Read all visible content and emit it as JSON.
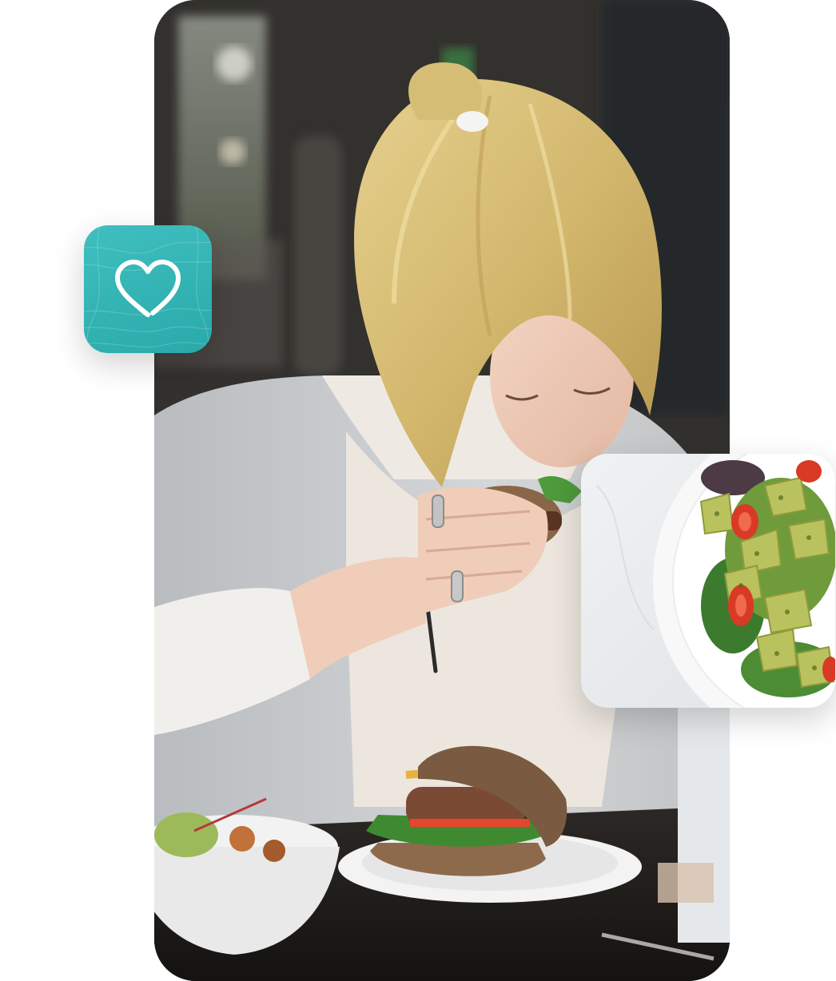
{
  "scene": {
    "main_photo": {
      "subject": "woman-eating-burger"
    },
    "side_photo": {
      "subject": "pasta-salad-bowl"
    },
    "app_icon": {
      "icon": "heart-icon",
      "background": "#2fb3b4"
    }
  },
  "colors": {
    "teal": "#2fb3b4",
    "hair": "#d9c07a",
    "sweater": "#c9cbcd",
    "collar": "#eeeae3",
    "table": "#1f1d1b"
  }
}
